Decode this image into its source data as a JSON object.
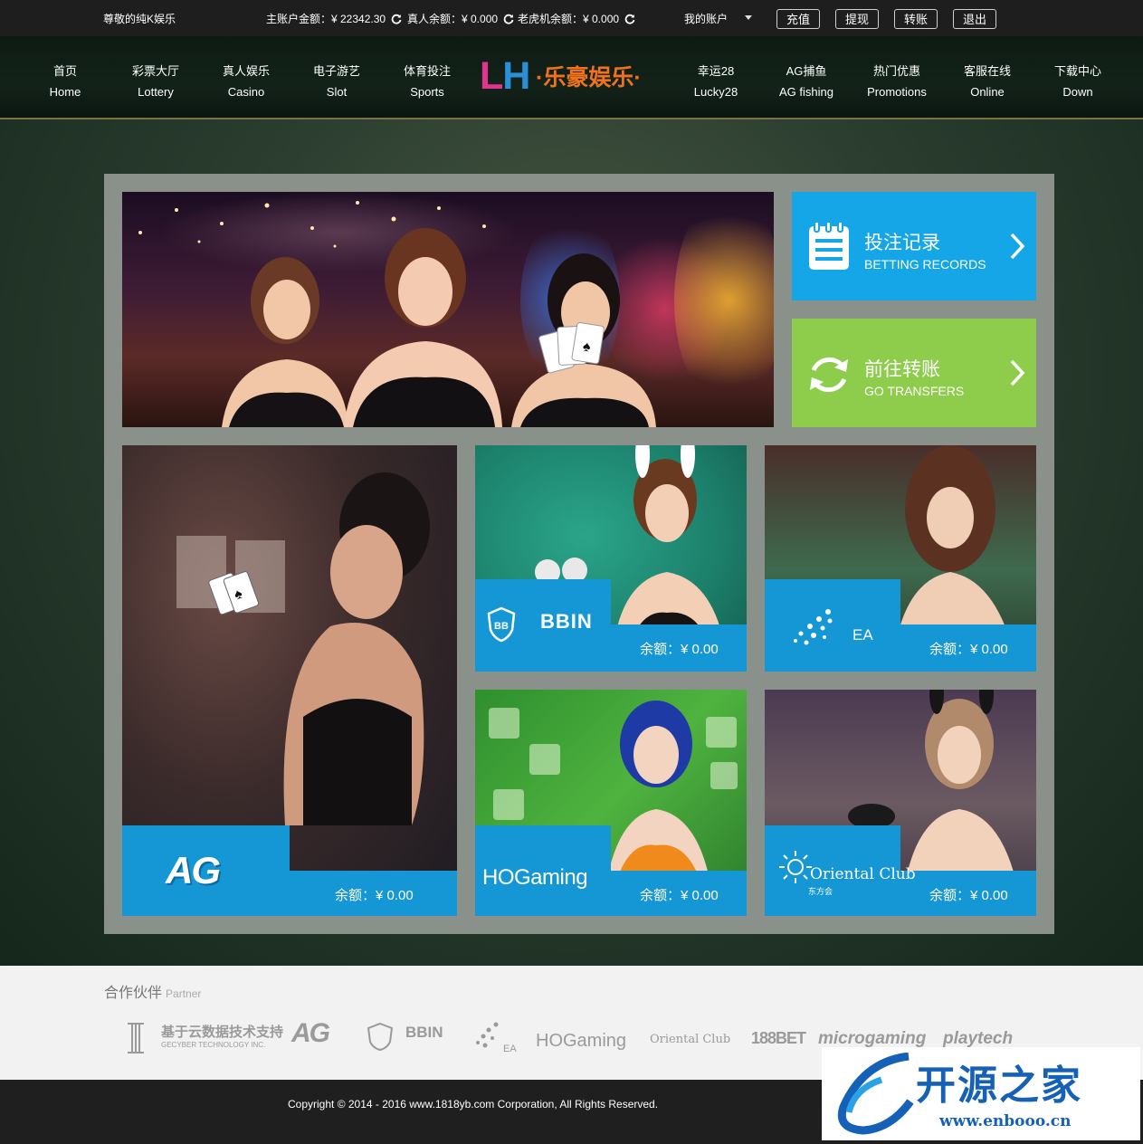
{
  "topbar": {
    "greeting": "尊敬的纯K娱乐",
    "main_balance": "主账户金额：¥ 22342.30",
    "live_balance": "真人余额：¥ 0.000",
    "slot_balance": "老虎机余额：¥ 0.000",
    "account": "我的账户",
    "buttons": [
      "充值",
      "提现",
      "转账",
      "退出"
    ]
  },
  "nav": {
    "left": [
      {
        "cn": "首页",
        "en": "Home"
      },
      {
        "cn": "彩票大厅",
        "en": "Lottery"
      },
      {
        "cn": "真人娱乐",
        "en": "Casino"
      },
      {
        "cn": "电子游艺",
        "en": "Slot"
      },
      {
        "cn": "体育投注",
        "en": "Sports"
      }
    ],
    "right": [
      {
        "cn": "幸运28",
        "en": "Lucky28"
      },
      {
        "cn": "AG捕鱼",
        "en": "AG fishing"
      },
      {
        "cn": "热门优惠",
        "en": "Promotions"
      },
      {
        "cn": "客服在线",
        "en": "Online"
      },
      {
        "cn": "下载中心",
        "en": "Down"
      }
    ],
    "logo_letters": [
      "L",
      "H"
    ],
    "logo_text": "·乐豪娱乐·"
  },
  "quick": [
    {
      "cn": "投注记录",
      "en": "BETTING RECORDS",
      "color": "#14a6e6",
      "icon": "clipboard-icon"
    },
    {
      "cn": "前往转账",
      "en": "GO TRANSFERS",
      "color": "#8dcd4b",
      "icon": "refresh-icon"
    }
  ],
  "tiles": [
    {
      "brand": "AG",
      "balance": "余额：¥ 0.00"
    },
    {
      "brand": "BBIN",
      "balance": "余额：¥ 0.00"
    },
    {
      "brand": "EA",
      "balance": "余额：¥ 0.00"
    },
    {
      "brand": "HOGaming",
      "balance": "余额：¥ 0.00"
    },
    {
      "brand": "Oriental Club",
      "brand_sub": "东方会",
      "balance": "余额：¥ 0.00"
    }
  ],
  "partners": {
    "title": "合作伙伴",
    "subtitle": "Partner",
    "logos": [
      "基于云数据技术支持",
      "AG",
      "BBIN",
      "EA",
      "HOGaming",
      "Oriental Club",
      "188BET",
      "microgaming",
      "playtech"
    ],
    "gecyber_sub": "GECYBER TECHNOLOGY INC."
  },
  "footer": {
    "copyright": "Copyright © 2014 - 2016 www.1818yb.com Corporation, All Rights Reserved."
  },
  "watermark": {
    "title": "开源之家",
    "url": "www.enbooo.cn"
  }
}
